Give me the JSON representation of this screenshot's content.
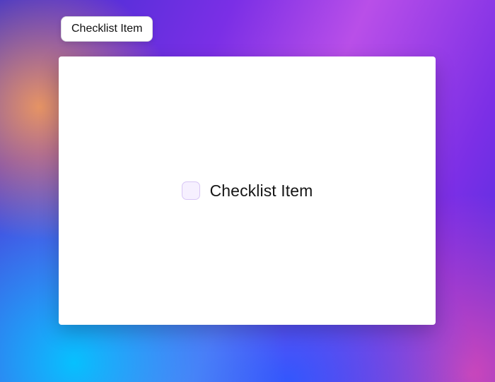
{
  "badge": {
    "label": "Checklist Item"
  },
  "card": {
    "item": {
      "label": "Checklist Item",
      "checked": false
    }
  }
}
